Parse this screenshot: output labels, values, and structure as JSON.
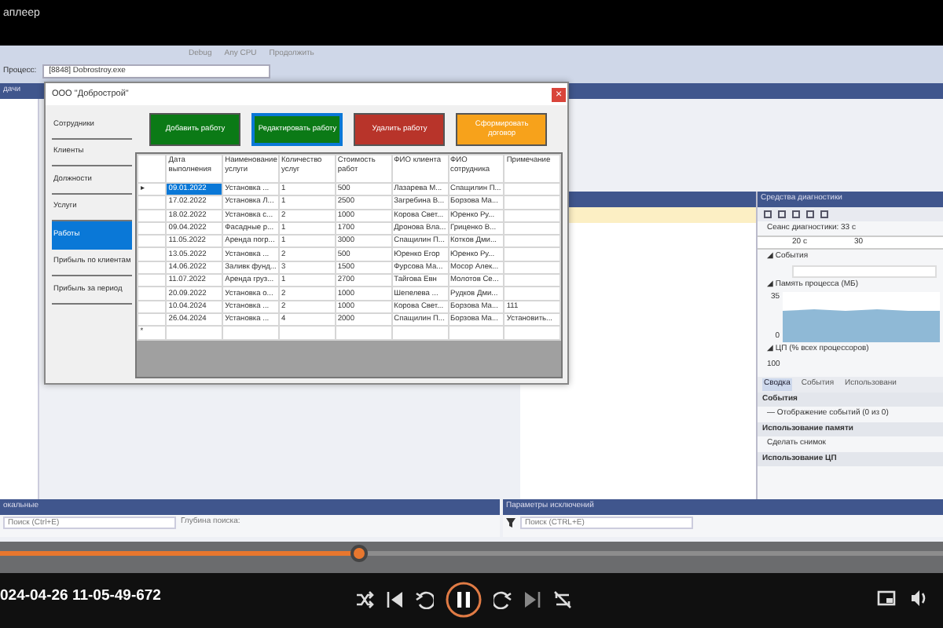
{
  "player_title": "аплеер",
  "vs": {
    "toolbar": [
      "Debug",
      "Any CPU",
      "Продолжить"
    ],
    "process_label": "Процесс:",
    "process": "[8848] Dobrostroy.exe",
    "left_header": "дачи"
  },
  "app": {
    "title": "ООО \"Добрострой\"",
    "close": "×",
    "nav": [
      {
        "label": "Сотрудники",
        "selected": false
      },
      {
        "label": "Клиенты",
        "selected": false
      },
      {
        "label": "Должности",
        "selected": false
      },
      {
        "label": "Услуги",
        "selected": false
      },
      {
        "label": "Работы",
        "selected": true
      },
      {
        "label": "Прибыль по клиентам",
        "selected": false
      },
      {
        "label": "Прибыль за период",
        "selected": false
      }
    ],
    "actions": [
      {
        "label": "Добавить работу",
        "color": "#0b7a16",
        "focused": false
      },
      {
        "label": "Редактировать работу",
        "color": "#0b7a16",
        "focused": true
      },
      {
        "label": "Удалить работу",
        "color": "#b8342a",
        "focused": false
      },
      {
        "label": "Сформировать договор",
        "color": "#f7a21b",
        "focused": false
      }
    ],
    "columns": [
      "Дата выполнения",
      "Наименование услуги",
      "Количество услуг",
      "Стоимость работ",
      "ФИО клиента",
      "ФИО сотрудника",
      "Примечание"
    ],
    "rows": [
      {
        "current": true,
        "cells": [
          "09.01.2022",
          "Установка ...",
          "1",
          "500",
          "Лазарева М...",
          "Спащилин П...",
          ""
        ]
      },
      {
        "current": false,
        "cells": [
          "17.02.2022",
          "Установка Л...",
          "1",
          "2500",
          "Загребина В...",
          "Борзова Ма...",
          ""
        ]
      },
      {
        "current": false,
        "cells": [
          "18.02.2022",
          "Установка с...",
          "2",
          "1000",
          "Корова Свет...",
          "Юренко Ру...",
          ""
        ]
      },
      {
        "current": false,
        "cells": [
          "09.04.2022",
          "Фасадные р...",
          "1",
          "1700",
          "Дронова Вла...",
          "Гриценко В...",
          ""
        ]
      },
      {
        "current": false,
        "cells": [
          "11.05.2022",
          "Аренда погр...",
          "1",
          "3000",
          "Спащилин П...",
          "Котков Дми...",
          ""
        ]
      },
      {
        "current": false,
        "cells": [
          "13.05.2022",
          "Установка ...",
          "2",
          "500",
          "Юренко Егор",
          "Юренко Ру...",
          ""
        ]
      },
      {
        "current": false,
        "cells": [
          "14.06.2022",
          "Заливк фунд...",
          "3",
          "1500",
          "Фурсова Ма...",
          "Мосор Алек...",
          ""
        ]
      },
      {
        "current": false,
        "cells": [
          "11.07.2022",
          "Аренда груз...",
          "1",
          "2700",
          "Тайгова Евн",
          "Молотов Се...",
          ""
        ]
      },
      {
        "current": false,
        "cells": [
          "20.09.2022",
          "Установка о...",
          "2",
          "1000",
          "Шепелева ...",
          "Рудков Дми...",
          ""
        ]
      },
      {
        "current": false,
        "cells": [
          "10.04.2024",
          "Установка ...",
          "2",
          "1000",
          "Корова Свет...",
          "Борзова Ма...",
          "111"
        ]
      },
      {
        "current": false,
        "cells": [
          "26.04.2024",
          "Установка ...",
          "4",
          "2000",
          "Спащилин П...",
          "Борзова Ма...",
          "Установить..."
        ]
      }
    ],
    "new_row_marker": "*",
    "current_marker": "▸"
  },
  "diagnostics": {
    "title": "Средства диагностики",
    "session": "Сеанс диагностики: 33 с",
    "ticks": [
      "20 с",
      "30"
    ],
    "events_label": "◢ События",
    "memory_label": "◢ Память процесса (МБ)",
    "memory_max": "35",
    "memory_min": "0",
    "cpu_label": "◢ ЦП (% всех процессоров)",
    "cpu_max": "100",
    "tabs": [
      {
        "label": "Сводка",
        "selected": true
      },
      {
        "label": "События",
        "selected": false
      },
      {
        "label": "Использовани",
        "selected": false
      }
    ],
    "sections": [
      {
        "kind": "heading",
        "text": "События"
      },
      {
        "kind": "item",
        "text": "— Отображение событий (0 из 0)"
      },
      {
        "kind": "heading",
        "text": "Использование памяти"
      },
      {
        "kind": "item",
        "text": "Сделать снимок"
      },
      {
        "kind": "heading",
        "text": "Использование ЦП"
      }
    ]
  },
  "bottom": {
    "locals_title": "окальные",
    "locals_search": "Поиск (Ctrl+E)",
    "depth": "Глубина поиска:",
    "exceptions_title": "Параметры исключений",
    "exceptions_search": "Поиск (CTRL+E)"
  },
  "player": {
    "progress": {
      "level": 0.38
    },
    "timestamp": "024-04-26 11-05-49-672",
    "playing": true
  }
}
